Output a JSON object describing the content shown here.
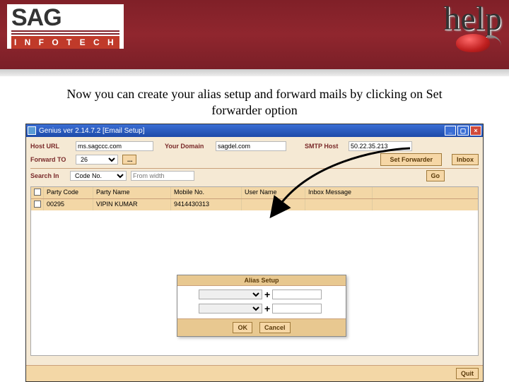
{
  "banner": {
    "logo_top": "SAG",
    "logo_bottom": "I N F O T E C H",
    "help_text": "help"
  },
  "instruction": "Now you can create your alias setup and forward mails by clicking on Set forwarder option",
  "titlebar": {
    "title": "Genius ver 2.14.7.2  [Email Setup]"
  },
  "form": {
    "host_url_label": "Host URL",
    "host_url_value": "ms.sagccc.com",
    "your_domain_label": "Your Domain",
    "your_domain_value": "sagdel.com",
    "smtp_host_label": "SMTP Host",
    "smtp_host_value": "50.22.35.213",
    "forward_to_label": "Forward TO",
    "forward_to_value": "26",
    "set_forwarder_label": "Set Forwarder",
    "inbox_label": "Inbox",
    "search_in_label": "Search In",
    "search_in_value": "Code No.",
    "from_width_label": "From width",
    "go_label": "Go",
    "ellipsis": "..."
  },
  "grid": {
    "headers": {
      "chk": "",
      "c1": "Party Code",
      "c2": "Party Name",
      "c3": "Mobile No.",
      "c4": "User Name",
      "c5": "Inbox Message"
    },
    "row": {
      "c1": "00295",
      "c2": "VIPIN KUMAR",
      "c3": "9414430313",
      "c4": "",
      "c5": ""
    }
  },
  "alias": {
    "title": "Alias Setup",
    "ok": "OK",
    "cancel": "Cancel"
  },
  "bottom": {
    "quit": "Quit"
  }
}
